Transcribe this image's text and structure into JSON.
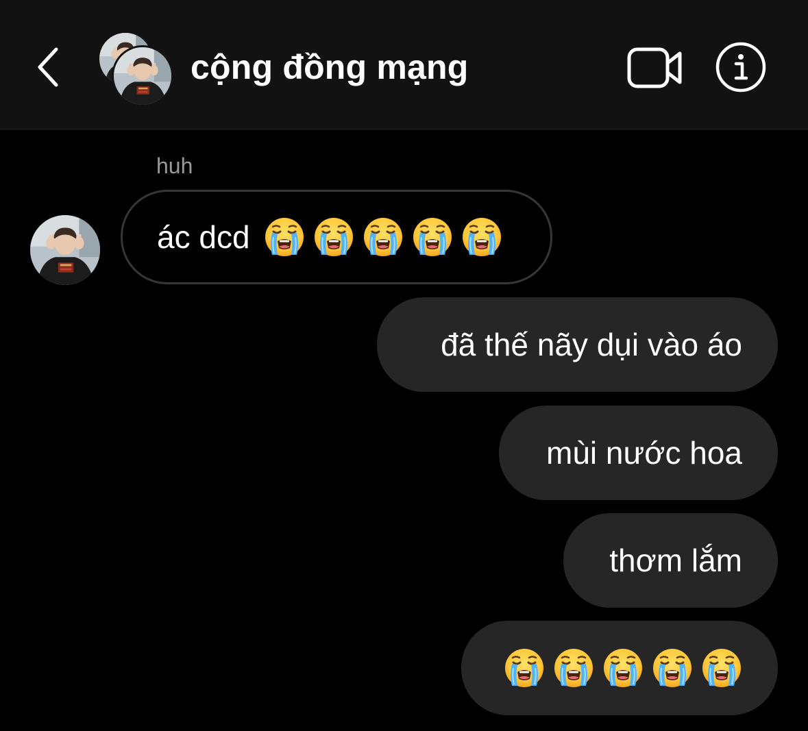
{
  "header": {
    "title": "cộng đồng mạng",
    "back_icon": "chevron-left-icon",
    "video_icon": "video-camera-icon",
    "info_icon": "info-icon"
  },
  "messages": {
    "reply_label": "huh",
    "received": [
      {
        "text": "ác dcd",
        "emoji_count": 5,
        "emoji": "loudly-crying-face"
      }
    ],
    "sent": [
      {
        "text": "đã thế nãy dụi vào áo"
      },
      {
        "text": "mùi nước hoa"
      },
      {
        "text": "thơm lắm"
      },
      {
        "text": "",
        "emoji_count": 5,
        "emoji": "loudly-crying-face"
      }
    ]
  },
  "colors": {
    "background": "#000000",
    "header_background": "#121212",
    "sent_bubble": "#262626",
    "received_border": "#363636",
    "secondary_text": "#9a9a9a"
  }
}
